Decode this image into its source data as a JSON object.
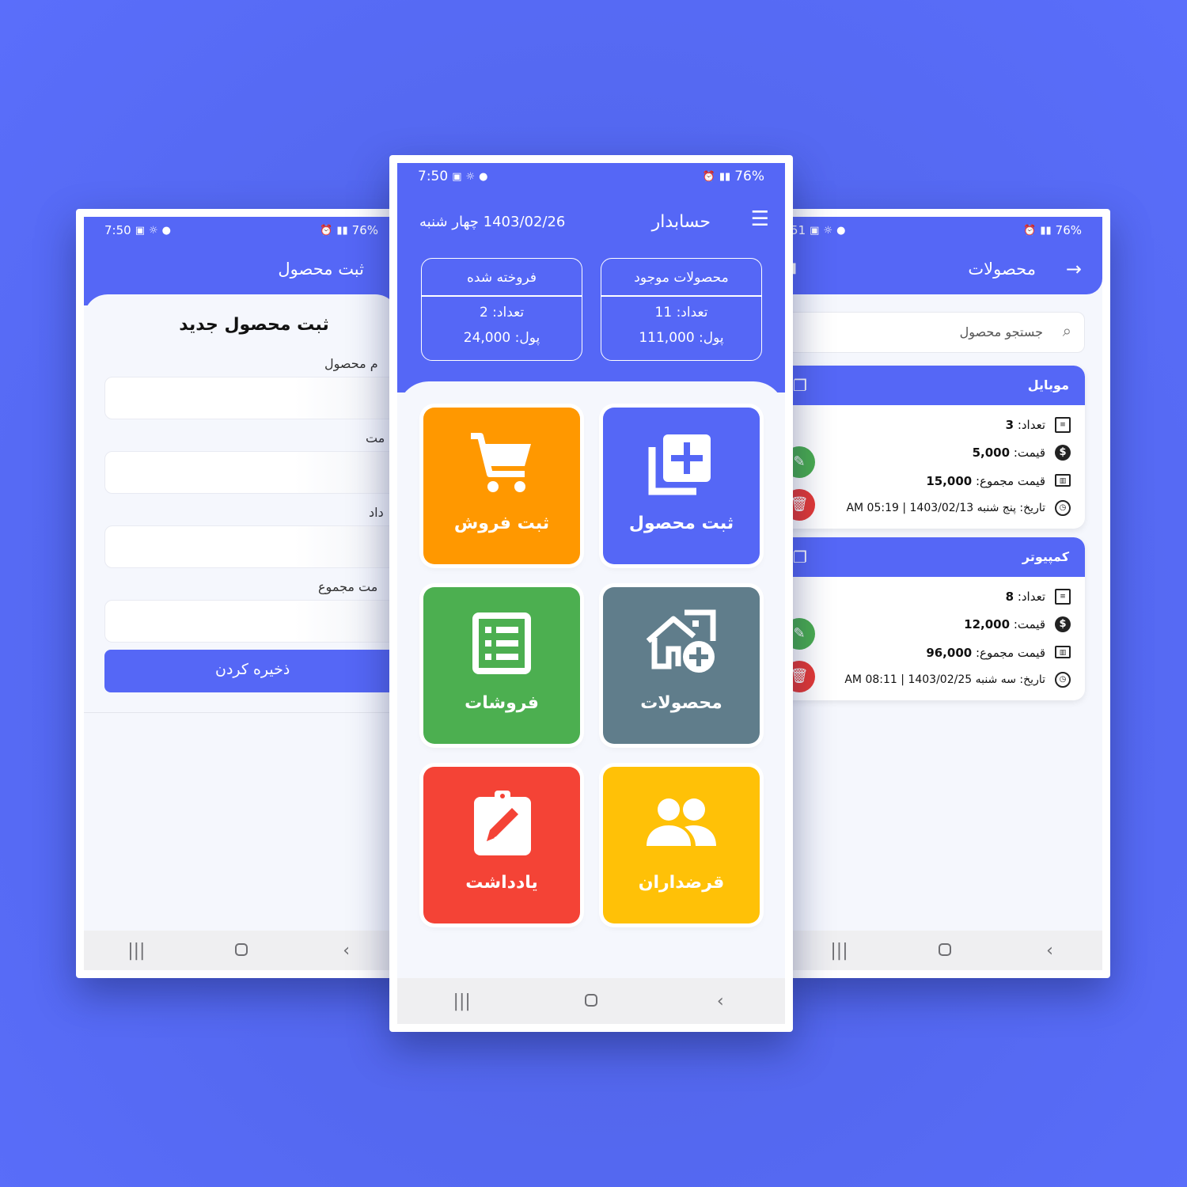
{
  "colors": {
    "background": "#5468f0",
    "primary": "#5567f6",
    "orange": "#ff9800",
    "green": "#4caf50",
    "slate": "#607d8b",
    "red": "#f44336",
    "yellow": "#ffc107"
  },
  "status": {
    "time": "7:50",
    "battery": "76%",
    "right_time": ":51"
  },
  "left_screen": {
    "header_title": "ثبت محصول",
    "form_title": "ثبت محصول جدید",
    "fields": [
      {
        "label": "نام محصول",
        "visible_label": "م محصول"
      },
      {
        "label": "قیمت",
        "visible_label": "مت"
      },
      {
        "label": "تعداد",
        "visible_label": "داد"
      },
      {
        "label": "قیمت مجموع",
        "visible_label": "مت مجموع"
      }
    ],
    "save_label": "ذخیره کردن"
  },
  "center_screen": {
    "app_title": "حسابدار",
    "date": "1403/02/26 چهار شنبه",
    "stats": [
      {
        "title": "محصولات موجود",
        "count": "تعداد: 11",
        "money": "پول: 111,000"
      },
      {
        "title": "فروخته شده",
        "count": "تعداد: 2",
        "money": "پول: 24,000"
      }
    ],
    "tiles": [
      {
        "label": "ثبت محصول",
        "icon": "add-product-icon"
      },
      {
        "label": "ثبت فروش",
        "icon": "cart-icon"
      },
      {
        "label": "محصولات",
        "icon": "store-add-icon"
      },
      {
        "label": "فروشات",
        "icon": "list-icon"
      },
      {
        "label": "قرضداران",
        "icon": "people-icon"
      },
      {
        "label": "یادداشت",
        "icon": "note-edit-icon"
      }
    ]
  },
  "right_screen": {
    "header_title": "محصولات",
    "search_placeholder": "جستجو محصول",
    "products": [
      {
        "name": "موبایل",
        "count_label": "تعداد:",
        "count": "3",
        "price_label": "قیمت:",
        "price": "5,000",
        "total_label": "قیمت مجموع:",
        "total": "15,000",
        "date_label": "تاریخ:",
        "date": "پنج شنبه 1403/02/13 | AM 05:19"
      },
      {
        "name": "کمپیوتر",
        "count_label": "تعداد:",
        "count": "8",
        "price_label": "قیمت:",
        "price": "12,000",
        "total_label": "قیمت مجموع:",
        "total": "96,000",
        "date_label": "تاریخ:",
        "date": "سه شنبه 1403/02/25 | AM 08:11"
      }
    ]
  }
}
